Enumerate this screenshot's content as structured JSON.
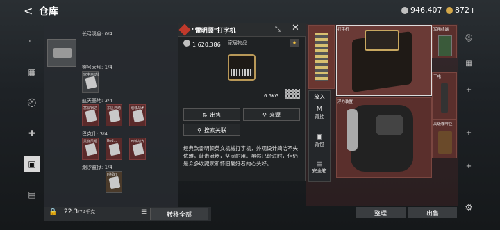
{
  "header": {
    "back_label": "<",
    "title": "仓库",
    "currency1": "946,407",
    "currency2": "872+",
    "coin1_color": "#c0c0c0",
    "coin2_color": "#d4a84a"
  },
  "list": {
    "sections": [
      {
        "label": "长弓溪谷: 0/4"
      },
      {
        "label": "零号大坝: 1/4"
      },
      {
        "label": "航天基地: 3/4"
      },
      {
        "label": "巴克什: 3/4"
      },
      {
        "label": "潮汐监狱: 1/4"
      }
    ],
    "slot_texts": [
      "家电自动装",
      "富翁钢达",
      "东区自动",
      "组装战术",
      "黑旋风组",
      "Red...",
      "西城战支",
      "[待取]"
    ]
  },
  "bottom": {
    "weight": "22.3",
    "weight_unit": "/74千克",
    "transfer_label": "转移全部"
  },
  "popup": {
    "name": "\"雷明顿\"打字机",
    "price": "1,620,386",
    "category": "家居物品",
    "weight": "6.5KG",
    "sell_label": "出售",
    "source_label": "来源",
    "search_label": "搜索关联",
    "description": "经典款雷明顿英文机械打字机，外观设计简洁不失优雅，敲击流畅，坚固耐用。虽然已经过时，但仍是众多收藏家和怀旧爱好者的心头好。"
  },
  "put": {
    "header": "放入",
    "items": [
      "背挂",
      "背包",
      "安全箱"
    ]
  },
  "right": {
    "labels": [
      "打字机",
      "军用终端",
      "干电",
      "浮力装置",
      "高级咖啡豆"
    ],
    "sort_label": "整理",
    "sell_label": "出售"
  }
}
